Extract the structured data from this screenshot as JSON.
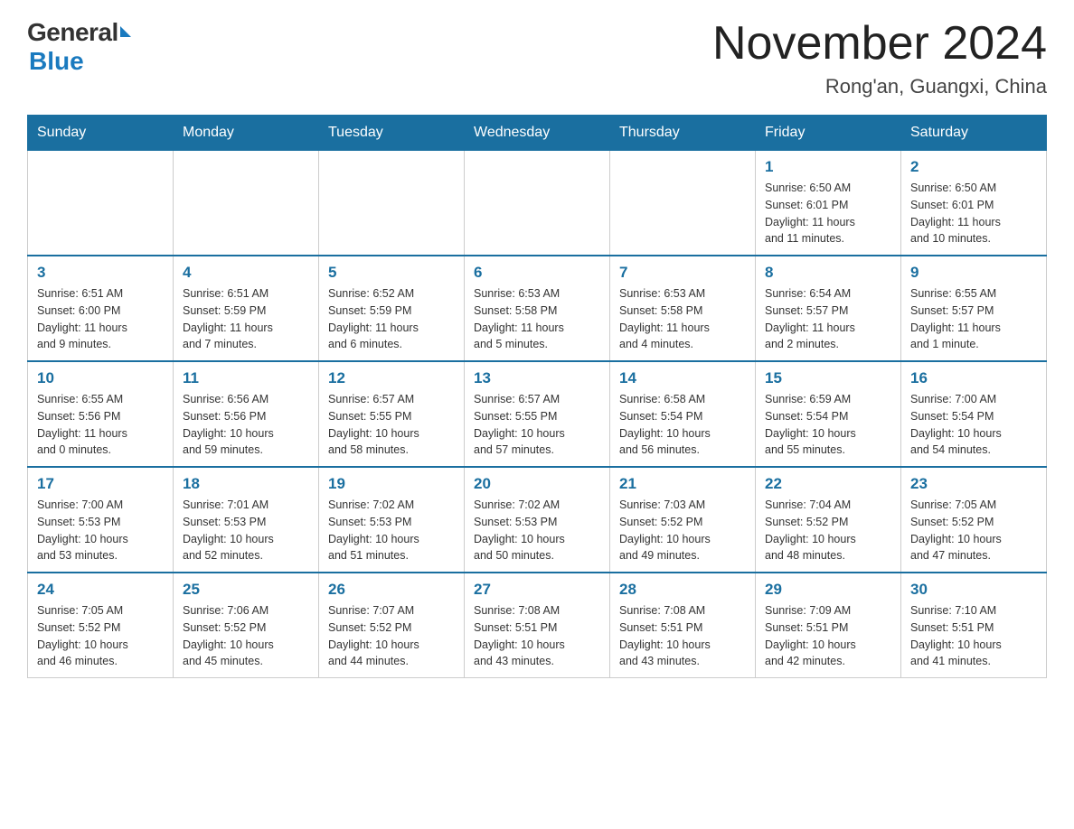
{
  "header": {
    "logo_general": "General",
    "logo_blue": "Blue",
    "month_title": "November 2024",
    "location": "Rong'an, Guangxi, China"
  },
  "days_of_week": [
    "Sunday",
    "Monday",
    "Tuesday",
    "Wednesday",
    "Thursday",
    "Friday",
    "Saturday"
  ],
  "weeks": [
    [
      {
        "day": "",
        "info": ""
      },
      {
        "day": "",
        "info": ""
      },
      {
        "day": "",
        "info": ""
      },
      {
        "day": "",
        "info": ""
      },
      {
        "day": "",
        "info": ""
      },
      {
        "day": "1",
        "info": "Sunrise: 6:50 AM\nSunset: 6:01 PM\nDaylight: 11 hours\nand 11 minutes."
      },
      {
        "day": "2",
        "info": "Sunrise: 6:50 AM\nSunset: 6:01 PM\nDaylight: 11 hours\nand 10 minutes."
      }
    ],
    [
      {
        "day": "3",
        "info": "Sunrise: 6:51 AM\nSunset: 6:00 PM\nDaylight: 11 hours\nand 9 minutes."
      },
      {
        "day": "4",
        "info": "Sunrise: 6:51 AM\nSunset: 5:59 PM\nDaylight: 11 hours\nand 7 minutes."
      },
      {
        "day": "5",
        "info": "Sunrise: 6:52 AM\nSunset: 5:59 PM\nDaylight: 11 hours\nand 6 minutes."
      },
      {
        "day": "6",
        "info": "Sunrise: 6:53 AM\nSunset: 5:58 PM\nDaylight: 11 hours\nand 5 minutes."
      },
      {
        "day": "7",
        "info": "Sunrise: 6:53 AM\nSunset: 5:58 PM\nDaylight: 11 hours\nand 4 minutes."
      },
      {
        "day": "8",
        "info": "Sunrise: 6:54 AM\nSunset: 5:57 PM\nDaylight: 11 hours\nand 2 minutes."
      },
      {
        "day": "9",
        "info": "Sunrise: 6:55 AM\nSunset: 5:57 PM\nDaylight: 11 hours\nand 1 minute."
      }
    ],
    [
      {
        "day": "10",
        "info": "Sunrise: 6:55 AM\nSunset: 5:56 PM\nDaylight: 11 hours\nand 0 minutes."
      },
      {
        "day": "11",
        "info": "Sunrise: 6:56 AM\nSunset: 5:56 PM\nDaylight: 10 hours\nand 59 minutes."
      },
      {
        "day": "12",
        "info": "Sunrise: 6:57 AM\nSunset: 5:55 PM\nDaylight: 10 hours\nand 58 minutes."
      },
      {
        "day": "13",
        "info": "Sunrise: 6:57 AM\nSunset: 5:55 PM\nDaylight: 10 hours\nand 57 minutes."
      },
      {
        "day": "14",
        "info": "Sunrise: 6:58 AM\nSunset: 5:54 PM\nDaylight: 10 hours\nand 56 minutes."
      },
      {
        "day": "15",
        "info": "Sunrise: 6:59 AM\nSunset: 5:54 PM\nDaylight: 10 hours\nand 55 minutes."
      },
      {
        "day": "16",
        "info": "Sunrise: 7:00 AM\nSunset: 5:54 PM\nDaylight: 10 hours\nand 54 minutes."
      }
    ],
    [
      {
        "day": "17",
        "info": "Sunrise: 7:00 AM\nSunset: 5:53 PM\nDaylight: 10 hours\nand 53 minutes."
      },
      {
        "day": "18",
        "info": "Sunrise: 7:01 AM\nSunset: 5:53 PM\nDaylight: 10 hours\nand 52 minutes."
      },
      {
        "day": "19",
        "info": "Sunrise: 7:02 AM\nSunset: 5:53 PM\nDaylight: 10 hours\nand 51 minutes."
      },
      {
        "day": "20",
        "info": "Sunrise: 7:02 AM\nSunset: 5:53 PM\nDaylight: 10 hours\nand 50 minutes."
      },
      {
        "day": "21",
        "info": "Sunrise: 7:03 AM\nSunset: 5:52 PM\nDaylight: 10 hours\nand 49 minutes."
      },
      {
        "day": "22",
        "info": "Sunrise: 7:04 AM\nSunset: 5:52 PM\nDaylight: 10 hours\nand 48 minutes."
      },
      {
        "day": "23",
        "info": "Sunrise: 7:05 AM\nSunset: 5:52 PM\nDaylight: 10 hours\nand 47 minutes."
      }
    ],
    [
      {
        "day": "24",
        "info": "Sunrise: 7:05 AM\nSunset: 5:52 PM\nDaylight: 10 hours\nand 46 minutes."
      },
      {
        "day": "25",
        "info": "Sunrise: 7:06 AM\nSunset: 5:52 PM\nDaylight: 10 hours\nand 45 minutes."
      },
      {
        "day": "26",
        "info": "Sunrise: 7:07 AM\nSunset: 5:52 PM\nDaylight: 10 hours\nand 44 minutes."
      },
      {
        "day": "27",
        "info": "Sunrise: 7:08 AM\nSunset: 5:51 PM\nDaylight: 10 hours\nand 43 minutes."
      },
      {
        "day": "28",
        "info": "Sunrise: 7:08 AM\nSunset: 5:51 PM\nDaylight: 10 hours\nand 43 minutes."
      },
      {
        "day": "29",
        "info": "Sunrise: 7:09 AM\nSunset: 5:51 PM\nDaylight: 10 hours\nand 42 minutes."
      },
      {
        "day": "30",
        "info": "Sunrise: 7:10 AM\nSunset: 5:51 PM\nDaylight: 10 hours\nand 41 minutes."
      }
    ]
  ]
}
